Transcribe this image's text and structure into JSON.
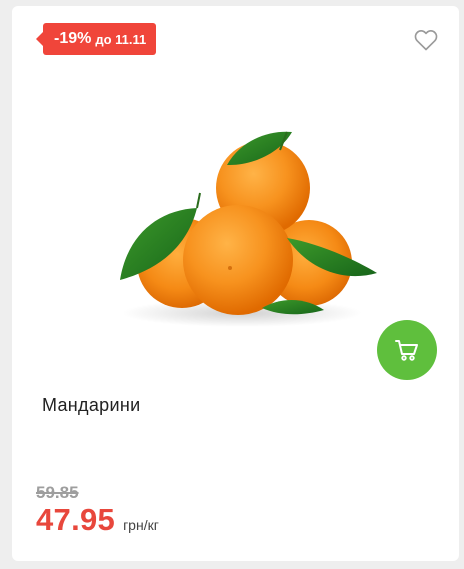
{
  "product": {
    "discount": {
      "percent": "-19%",
      "until": "до 11.11",
      "color": "#f0453a"
    },
    "favorite": {
      "icon": "heart-outline-icon"
    },
    "image": {
      "subject": "tangerines-photo"
    },
    "cart": {
      "icon": "shopping-cart-icon",
      "color": "#5fbf3d"
    },
    "name": "Мандарини",
    "old_price": "59.85",
    "price": "47.95",
    "unit": "грн/кг",
    "price_color": "#e8473c"
  }
}
